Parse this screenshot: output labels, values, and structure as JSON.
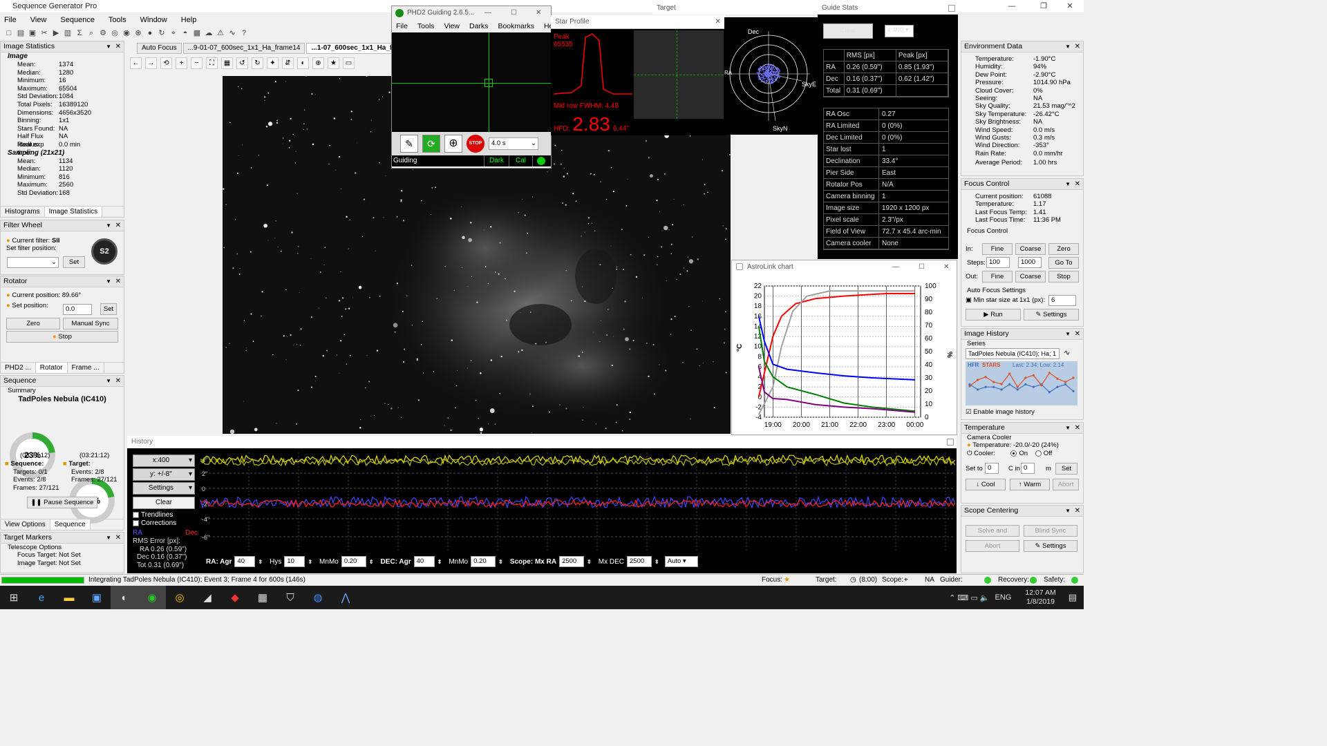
{
  "app": {
    "title": "Sequence Generator Pro",
    "menus": [
      "File",
      "View",
      "Sequence",
      "Tools",
      "Window",
      "Help"
    ]
  },
  "doc_tabs": [
    "Auto Focus",
    "...9-01-07_600sec_1x1_Ha_frame14",
    "...1-07_600sec_1x1_Ha_frame"
  ],
  "image_stats": {
    "title": "Image Statistics",
    "image_label": "Image",
    "rows": [
      [
        "Mean:",
        "1374"
      ],
      [
        "Median:",
        "1280"
      ],
      [
        "Minimum:",
        "16"
      ],
      [
        "Maximum:",
        "65504"
      ],
      [
        "Std Deviation:",
        "1084"
      ],
      [
        "Total Pixels:",
        "16389120"
      ],
      [
        "Dimensions:",
        "4656x3520"
      ],
      [
        "Binning:",
        "1x1"
      ],
      [
        "Stars Found:",
        "NA"
      ],
      [
        "Half Flux Radius:",
        "NA"
      ],
      [
        "Ideal exp time:",
        "0.0 min"
      ]
    ],
    "sampling_label": "Sampling (21x21)",
    "sampling": [
      [
        "Mean:",
        "1134"
      ],
      [
        "Median:",
        "1120"
      ],
      [
        "Minimum:",
        "816"
      ],
      [
        "Maximum:",
        "2560"
      ],
      [
        "Std Deviation:",
        "168"
      ]
    ],
    "tabs": [
      "Histograms",
      "Image Statistics"
    ]
  },
  "filter_wheel": {
    "title": "Filter Wheel",
    "current_label": "Current filter:",
    "current": "SII",
    "set_label": "Set filter position:",
    "set_btn": "Set",
    "badge": "S2"
  },
  "rotator": {
    "title": "Rotator",
    "pos_label": "Current position:",
    "pos": "89.66°",
    "set_label": "Set position:",
    "set_val": "0.0",
    "set_btn": "Set",
    "zero": "Zero",
    "manual": "Manual Sync",
    "stop": "Stop",
    "tabs": [
      "PHD2 ...",
      "Rotator",
      "Frame ..."
    ]
  },
  "sequence": {
    "title": "Sequence",
    "summary": "Summary",
    "target_name": "TadPoles Nebula (IC410)",
    "pct1": "23%",
    "pct2": "22%",
    "time1": "(03:21:12)",
    "time2": "(03:21:12)",
    "seq_label": "Sequence:",
    "tgt_label": "Target:",
    "seq_rows": [
      [
        "Targets:",
        "0/1"
      ],
      [
        "Events:",
        "2/8"
      ],
      [
        "Frames:",
        "27/121"
      ]
    ],
    "tgt_rows": [
      [
        "Events:",
        "2/8"
      ],
      [
        "Frames:",
        "27/121"
      ]
    ],
    "pause": "Pause Sequence",
    "tabs": [
      "View Options",
      "Sequence"
    ]
  },
  "target_markers": {
    "title": "Target Markers",
    "sub": "Telescope Options",
    "rows": [
      [
        "Focus Target:",
        "Not Set"
      ],
      [
        "Image Target:",
        "Not Set"
      ]
    ]
  },
  "phd2": {
    "title": "PHD2 Guiding 2.6.5...",
    "menus": [
      "File",
      "Tools",
      "View",
      "Darks",
      "Bookmarks",
      "Help"
    ],
    "exposure": "4.0 s",
    "status": "Guiding",
    "dark": "Dark",
    "cal": "Cal"
  },
  "star_profile": {
    "title": "Star Profile",
    "peak_label": "Peak",
    "peak": "65535",
    "fwhm": "Mid row FWHM: 4.48",
    "hfd_label": "HFD:",
    "hfd": "2.83",
    "hfd_arc": "6.44\""
  },
  "target_win": {
    "title": "Target",
    "dec": "Dec",
    "skye": "SkyE",
    "skyn": "SkyN",
    "ra": "RA"
  },
  "guide_stats": {
    "title": "Guide Stats",
    "clear": "Clear",
    "scale": "x:400",
    "header": [
      "",
      "RMS [px]",
      "Peak [px]"
    ],
    "rows": [
      [
        "RA",
        "0.26 (0.59\")",
        "0.85 (1.93\")"
      ],
      [
        "Dec",
        "0.16 (0.37\")",
        "0.62 (1.42\")"
      ],
      [
        "Total",
        "0.31 (0.69\")",
        ""
      ]
    ],
    "info": [
      [
        "RA Osc",
        "0.27"
      ],
      [
        "RA Limited",
        "0 (0%)"
      ],
      [
        "Dec Limited",
        "0 (0%)"
      ],
      [
        "Star lost",
        "1"
      ],
      [
        "Declination",
        "33.4°"
      ],
      [
        "Pier Side",
        "East"
      ],
      [
        "Rotator Pos",
        "N/A"
      ],
      [
        "Camera binning",
        "1"
      ],
      [
        "Image size",
        "1920 x 1200 px"
      ],
      [
        "Pixel scale",
        "2.3\"/px"
      ],
      [
        "Field of View",
        "72.7 x 45.4  arc-min"
      ],
      [
        "Camera cooler",
        "None"
      ]
    ]
  },
  "astrolink": {
    "title": "AstroLink chart",
    "chart_data": {
      "type": "line",
      "x": [
        "19:00",
        "20:00",
        "21:00",
        "22:00",
        "23:00",
        "00:00"
      ],
      "ylabel": "°C",
      "y2label": "%",
      "ylim": [
        -4,
        22
      ],
      "y2lim": [
        0,
        100
      ],
      "yticks": [
        "22",
        "20",
        "18",
        "16",
        "14",
        "12",
        "10",
        "8",
        "6",
        "4",
        "2",
        "0",
        "-2",
        "-4"
      ],
      "y2ticks": [
        "100",
        "90",
        "80",
        "70",
        "60",
        "50",
        "40",
        "30",
        "20",
        "10",
        "0"
      ],
      "series": [
        {
          "color": "#ff0000",
          "axis": "left",
          "values": [
            [
              18.5,
              0
            ],
            [
              19.0,
              12
            ],
            [
              19.3,
              16
            ],
            [
              19.8,
              18.5
            ],
            [
              20.5,
              19.5
            ],
            [
              21.5,
              20
            ],
            [
              23,
              20.5
            ],
            [
              24,
              20.5
            ]
          ]
        },
        {
          "color": "#a0a0a0",
          "axis": "left",
          "values": [
            [
              18.5,
              -3.5
            ],
            [
              19,
              2
            ],
            [
              19.3,
              10
            ],
            [
              19.7,
              17
            ],
            [
              20.2,
              20
            ],
            [
              21,
              21
            ],
            [
              24,
              21
            ]
          ]
        },
        {
          "color": "#0000ff",
          "axis": "left",
          "values": [
            [
              18.5,
              16
            ],
            [
              18.7,
              11
            ],
            [
              19,
              6.5
            ],
            [
              19.5,
              5.5
            ],
            [
              20.5,
              4.8
            ],
            [
              21.5,
              4.2
            ],
            [
              22.5,
              3.8
            ],
            [
              24,
              3.4
            ]
          ]
        },
        {
          "color": "#008000",
          "axis": "left",
          "values": [
            [
              18.5,
              14
            ],
            [
              18.7,
              7
            ],
            [
              19,
              4
            ],
            [
              19.5,
              2
            ],
            [
              20.5,
              0.5
            ],
            [
              21.5,
              -1.2
            ],
            [
              22.5,
              -2
            ],
            [
              24,
              -2.8
            ]
          ]
        },
        {
          "color": "#800080",
          "axis": "left",
          "values": [
            [
              18.5,
              6
            ],
            [
              18.7,
              1
            ],
            [
              19,
              -0.3
            ],
            [
              19.5,
              -0.5
            ],
            [
              20.5,
              -1.5
            ],
            [
              21.5,
              -2
            ],
            [
              22.5,
              -2.3
            ],
            [
              24,
              -3
            ]
          ]
        }
      ]
    }
  },
  "history": {
    "title": "History",
    "scale": "x:400",
    "yscale": "y: +/-8\"",
    "settings": "Settings",
    "clear": "Clear",
    "trendlines": "Trendlines",
    "corrections": "Corrections",
    "ra": "RA",
    "dec": "Dec",
    "err_label": "RMS Error [px]:",
    "err_ra": "RA 0.26 (0.59\")",
    "err_dec": "Dec 0.16 (0.37\")",
    "err_tot": "Tot 0.31 (0.69\")",
    "axis": [
      "4\"",
      "2\"",
      "0",
      "-2\"",
      "-4\"",
      "-6\""
    ],
    "controls": {
      "ra_agr": "RA: Agr",
      "ra_agr_v": "40",
      "hys": "Hys",
      "hys_v": "10",
      "mnmo": "MnMo",
      "mnmo_v": "0.20",
      "dec_agr": "DEC: Agr",
      "dec_agr_v": "40",
      "mnmo2": "MnMo",
      "mnmo2_v": "0.20",
      "scope": "Scope: Mx RA",
      "mxra_v": "2500",
      "mxdec": "Mx DEC",
      "mxdec_v": "2500",
      "auto": "Auto"
    }
  },
  "env": {
    "title": "Environment Data",
    "rows": [
      [
        "Temperature:",
        "-1.90°C"
      ],
      [
        "Humidity:",
        "94%"
      ],
      [
        "Dew Point:",
        "-2.90°C"
      ],
      [
        "Pressure:",
        "1014.90 hPa"
      ],
      [
        "Cloud Cover:",
        "0%"
      ],
      [
        "Seeing:",
        "NA"
      ],
      [
        "Sky Quality:",
        "21.53 mag/''^2"
      ],
      [
        "Sky Temperature:",
        "-26.42°C"
      ],
      [
        "Sky Brightness:",
        "NA"
      ],
      [
        "Wind Speed:",
        "0.0 m/s"
      ],
      [
        "Wind Gusts:",
        "0.3 m/s"
      ],
      [
        "Wind Direction:",
        "-353°"
      ],
      [
        "Rain Rate:",
        "0.0 mm/hr"
      ]
    ],
    "avg_label": "Average Period:",
    "avg": "1.00 hrs"
  },
  "focus": {
    "title": "Focus Control",
    "rows": [
      [
        "Current position:",
        "61088"
      ],
      [
        "Temperature:",
        "1.17"
      ],
      [
        "Last Focus Temp:",
        "1.41"
      ],
      [
        "Last Focus Time:",
        "11:36 PM"
      ]
    ],
    "fc": "Focus Control",
    "in": "In:",
    "out": "Out:",
    "fine": "Fine",
    "coarse": "Coarse",
    "zero": "Zero",
    "steps": "Steps:",
    "s1": "100",
    "s2": "1000",
    "goto": "Go To",
    "stop": "Stop",
    "af": "Auto Focus Settings",
    "minstar": "Min star size at 1x1 (px):",
    "minstar_v": "6",
    "run": "Run",
    "settings": "Settings"
  },
  "img_history": {
    "title": "Image History",
    "series_label": "Series",
    "series": "TadPoles Nebula (IC410); Ha; 1",
    "hfr": "HFR",
    "stars": "STARS",
    "last": "Last: 2.34; Low: 2.14",
    "enable": "Enable image history",
    "hfr_values": [
      2.6,
      2.4,
      2.5,
      2.5,
      2.4,
      2.6,
      2.4,
      2.6,
      2.5,
      2.6,
      2.3,
      2.5,
      2.6,
      2.34
    ],
    "star_values": [
      40,
      55,
      62,
      50,
      45,
      70,
      38,
      60,
      66,
      42,
      72,
      58,
      50,
      60
    ]
  },
  "temperature": {
    "title": "Temperature",
    "cooler_label": "Camera Cooler",
    "temp": "Temperature: -20.0/-20 (24%)",
    "cooler": "Cooler:",
    "on": "On",
    "off": "Off",
    "setto": "Set to",
    "setv": "0",
    "c_in": "C in",
    "in_v": "0",
    "m": "m",
    "set": "Set",
    "cool": "Cool",
    "warm": "Warm",
    "abort": "Abort"
  },
  "scope_centering": {
    "title": "Scope Centering",
    "solve": "Solve and",
    "blind": "Blind Sync",
    "abort": "Abort",
    "settings": "Settings"
  },
  "status": {
    "progress": "Integrating TadPoles Nebula (IC410); Event 3; Frame 4 for 600s (146s)",
    "focus": "Focus:",
    "target": "Target:",
    "time": "(8:00)",
    "scope": "Scope:",
    "na": "NA",
    "guider": "Guider:",
    "recovery": "Recovery:",
    "safety": "Safety:"
  },
  "tray": {
    "lang": "ENG",
    "time": "12:07 AM",
    "date": "1/8/2019"
  },
  "colors": {
    "ra": "#0000ff",
    "dec": "#ff0000",
    "green": "#00c000",
    "yellow": "#f0f000"
  }
}
